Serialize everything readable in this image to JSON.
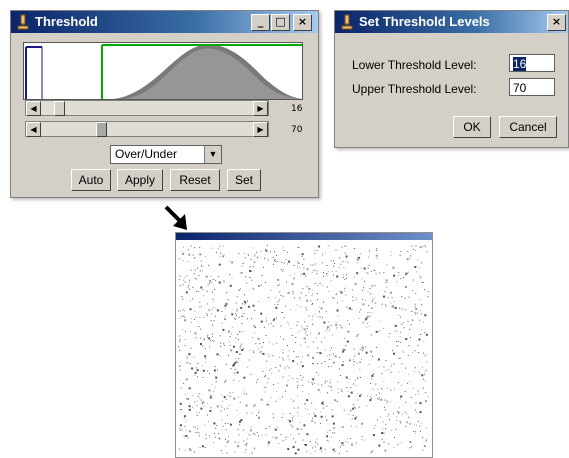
{
  "threshold_window": {
    "title": "Threshold",
    "minimize": "_",
    "maximize": "□",
    "close": "×",
    "lower_value": "16",
    "upper_value": "70",
    "lower_slider_fraction": 0.063,
    "upper_slider_fraction": 0.275,
    "mode": "Over/Under",
    "buttons": {
      "auto": "Auto",
      "apply": "Apply",
      "reset": "Reset",
      "set": "Set"
    }
  },
  "levels_dialog": {
    "title": "Set Threshold Levels",
    "close": "×",
    "lower_label": "Lower Threshold Level:",
    "lower_value": "16",
    "upper_label": "Upper Threshold Level:",
    "upper_value": "70",
    "ok": "OK",
    "cancel": "Cancel"
  },
  "image_window": {
    "title": "",
    "info": ""
  },
  "colors": {
    "titlebar": "#0a246a",
    "threshold_line": "#00aa00",
    "histogram_fill": "#707070"
  }
}
